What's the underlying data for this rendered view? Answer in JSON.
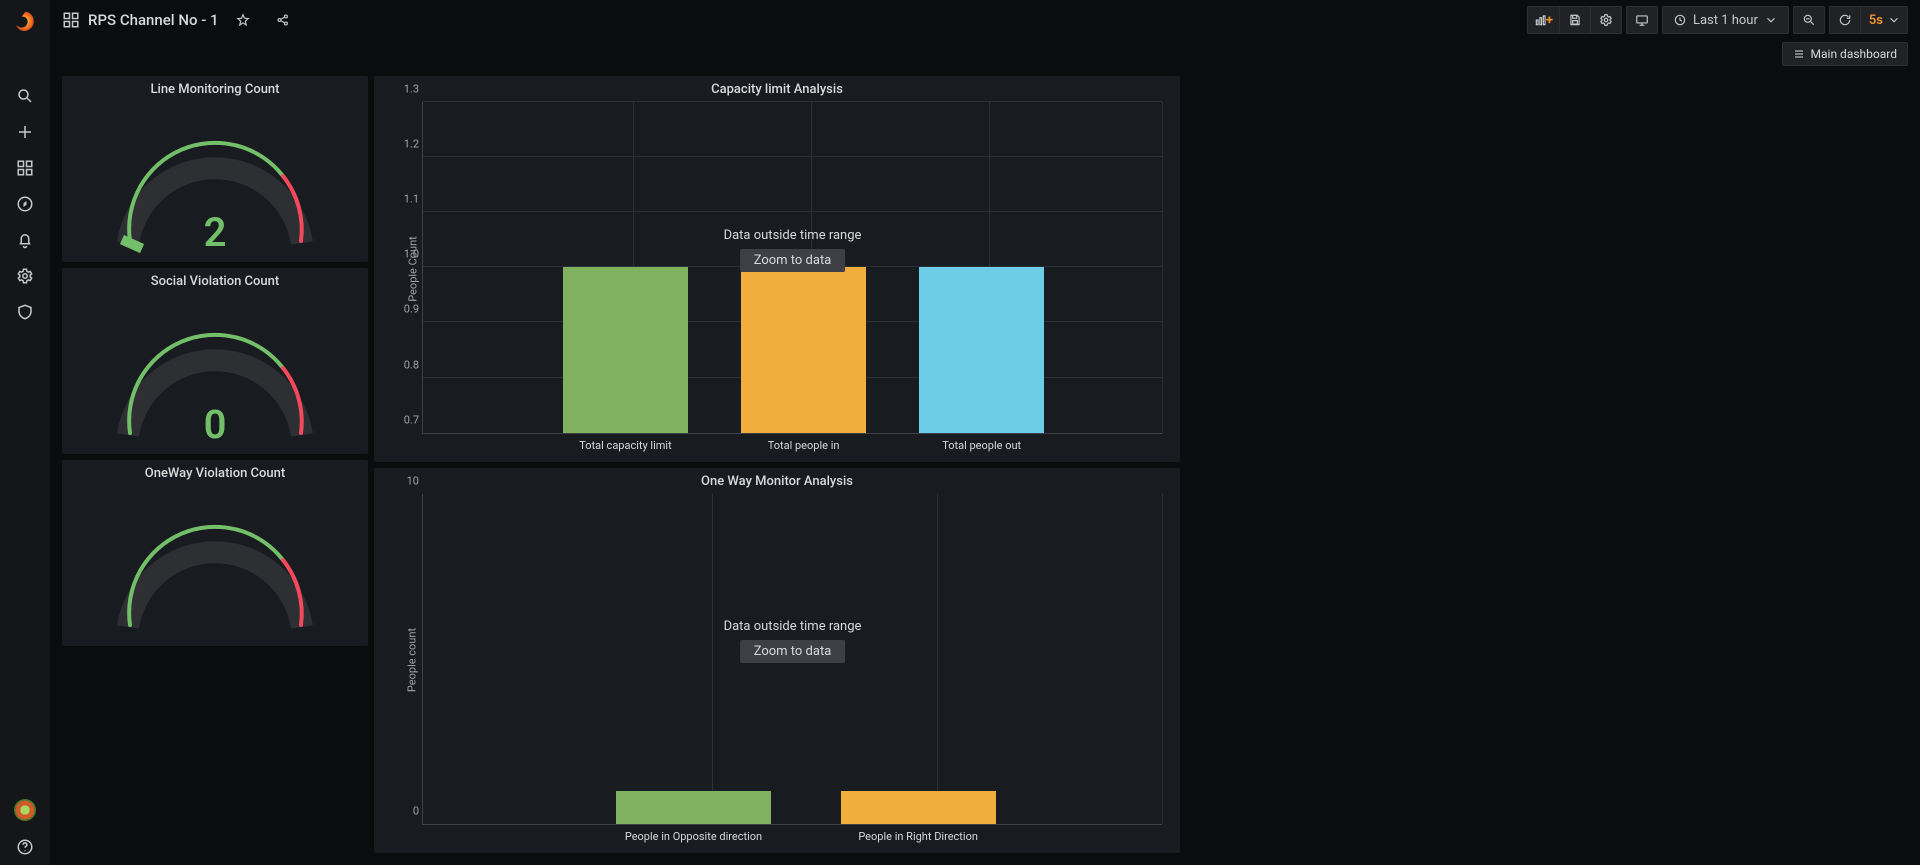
{
  "header": {
    "title": "RPS Channel No - 1",
    "time_range": "Last 1 hour",
    "refresh": "5s",
    "sublink": "Main dashboard"
  },
  "gauges": [
    {
      "title": "Line Monitoring Count",
      "value": "2"
    },
    {
      "title": "Social Violation Count",
      "value": "0"
    },
    {
      "title": "OneWay Violation Count",
      "value": ""
    }
  ],
  "charts": {
    "capacity": {
      "title": "Capacity limit Analysis",
      "ylabel": "People Count",
      "out_of_range_msg": "Data outside time range",
      "zoom_label": "Zoom to data"
    },
    "oneway": {
      "title": "One Way Monitor Analysis",
      "ylabel": "People count",
      "out_of_range_msg": "Data outside time range",
      "zoom_label": "Zoom to data"
    }
  },
  "chart_data": [
    {
      "id": "capacity",
      "type": "bar",
      "title": "Capacity limit Analysis",
      "ylabel": "People Count",
      "ylim": [
        0.7,
        1.3
      ],
      "yticks": [
        0.7,
        0.8,
        0.9,
        1.0,
        1.1,
        1.2,
        1.3
      ],
      "categories": [
        "Total capacity limit",
        "Total people in",
        "Total people out"
      ],
      "values": [
        1.0,
        1.0,
        1.0
      ],
      "colors": [
        "#80b160",
        "#f1ae3a",
        "#6ecde6"
      ],
      "note": "Data outside time range"
    },
    {
      "id": "oneway",
      "type": "bar",
      "title": "One Way Monitor Analysis",
      "ylabel": "People count",
      "ylim": [
        0,
        10
      ],
      "yticks": [
        0,
        10
      ],
      "categories": [
        "People in Opposite direction",
        "People in Right Direction"
      ],
      "values": [
        1,
        1
      ],
      "colors": [
        "#80b160",
        "#f1ae3a"
      ],
      "note": "Data outside time range"
    }
  ]
}
